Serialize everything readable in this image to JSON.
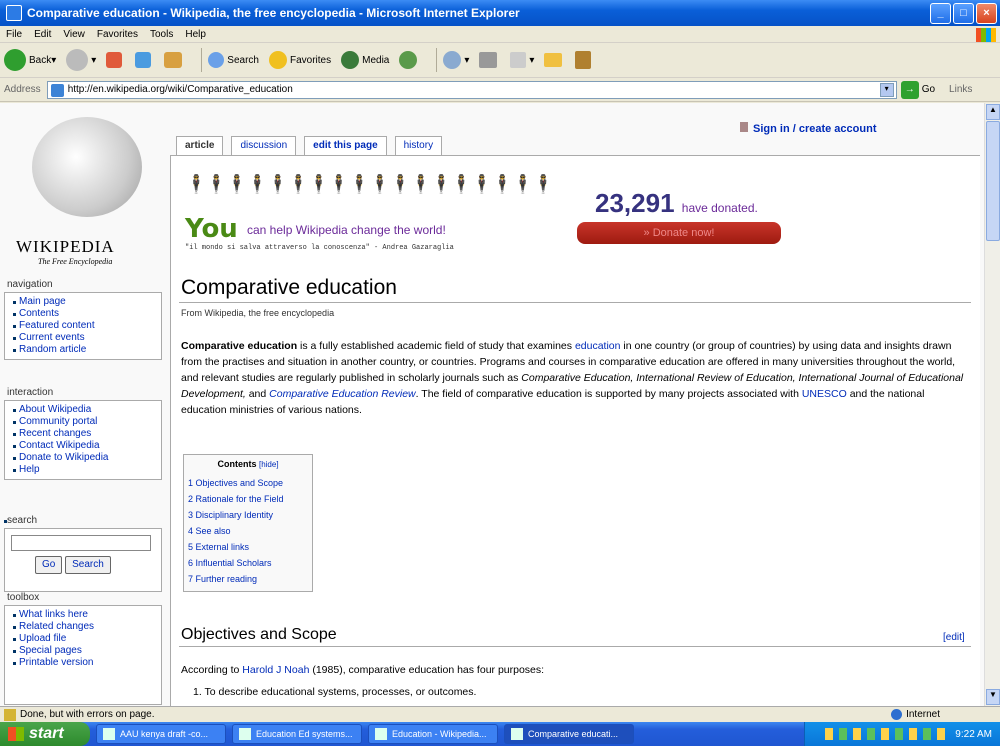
{
  "window": {
    "title": "Comparative education - Wikipedia, the free encyclopedia - Microsoft Internet Explorer"
  },
  "menu": [
    "File",
    "Edit",
    "View",
    "Favorites",
    "Tools",
    "Help"
  ],
  "toolbar": {
    "back": "Back",
    "search": "Search",
    "favorites": "Favorites",
    "media": "Media"
  },
  "address": {
    "label": "Address",
    "url": "http://en.wikipedia.org/wiki/Comparative_education",
    "go": "Go",
    "links": "Links"
  },
  "wiki": {
    "logo_title": "WIKIPEDIA",
    "tagline": "The Free Encyclopedia",
    "signin": "Sign in / create account",
    "tabs": [
      "article",
      "discussion",
      "edit this page",
      "history"
    ],
    "nav_heading": "navigation",
    "nav": [
      "Main page",
      "Contents",
      "Featured content",
      "Current events",
      "Random article"
    ],
    "interaction_heading": "interaction",
    "interaction": [
      "About Wikipedia",
      "Community portal",
      "Recent changes",
      "Contact Wikipedia",
      "Donate to Wikipedia",
      "Help"
    ],
    "search_heading": "search",
    "go_btn": "Go",
    "search_btn": "Search",
    "toolbox_heading": "toolbox",
    "toolbox": [
      "What links here",
      "Related changes",
      "Upload file",
      "Special pages",
      "Printable version"
    ]
  },
  "banner": {
    "you": "You",
    "help": "can help Wikipedia change the world!",
    "quote": "\"il mondo si salva attraverso la conoscenza\" - Andrea Gazaraglia",
    "count": "23,291",
    "donated": "have donated.",
    "donate_btn": "» Donate now!"
  },
  "article": {
    "title": "Comparative education",
    "from": "From Wikipedia, the free encyclopedia",
    "intro_bold": "Comparative education",
    "intro_1": " is a fully established academic field of study that examines ",
    "intro_link1": "education",
    "intro_2": " in one country (or group of countries) by using data and insights drawn from the practises and situation in another country, or countries. Programs and courses in comparative education are offered in many universities throughout the world, and relevant studies are regularly published in scholarly journals such as ",
    "intro_it": "Comparative Education, International Review of Education, International Journal of Educational Development,",
    "intro_3": " and ",
    "intro_link2": "Comparative Education Review",
    "intro_4": ". The field of comparative education is supported by many projects associated with ",
    "intro_link3": "UNESCO",
    "intro_5": " and the national education ministries of various nations.",
    "toc_title": "Contents",
    "toc_hide": "[hide]",
    "toc": [
      "1 Objectives and Scope",
      "2 Rationale for the Field",
      "3 Disciplinary Identity",
      "4 See also",
      "5 External links",
      "6 Influential Scholars",
      "7 Further reading"
    ],
    "section": "Objectives and Scope",
    "edit": "[edit]",
    "para2_a": "According to ",
    "para2_link": "Harold J Noah",
    "para2_b": " (1985), comparative education has four purposes:",
    "li1": "1.   To describe educational systems, processes, or outcomes."
  },
  "status": {
    "text": "Done, but with errors on page.",
    "zone": "Internet"
  },
  "taskbar": {
    "start": "start",
    "tasks": [
      "AAU kenya draft -co...",
      "Education Ed systems...",
      "Education - Wikipedia...",
      "Comparative educati..."
    ],
    "clock": "9:22 AM"
  }
}
